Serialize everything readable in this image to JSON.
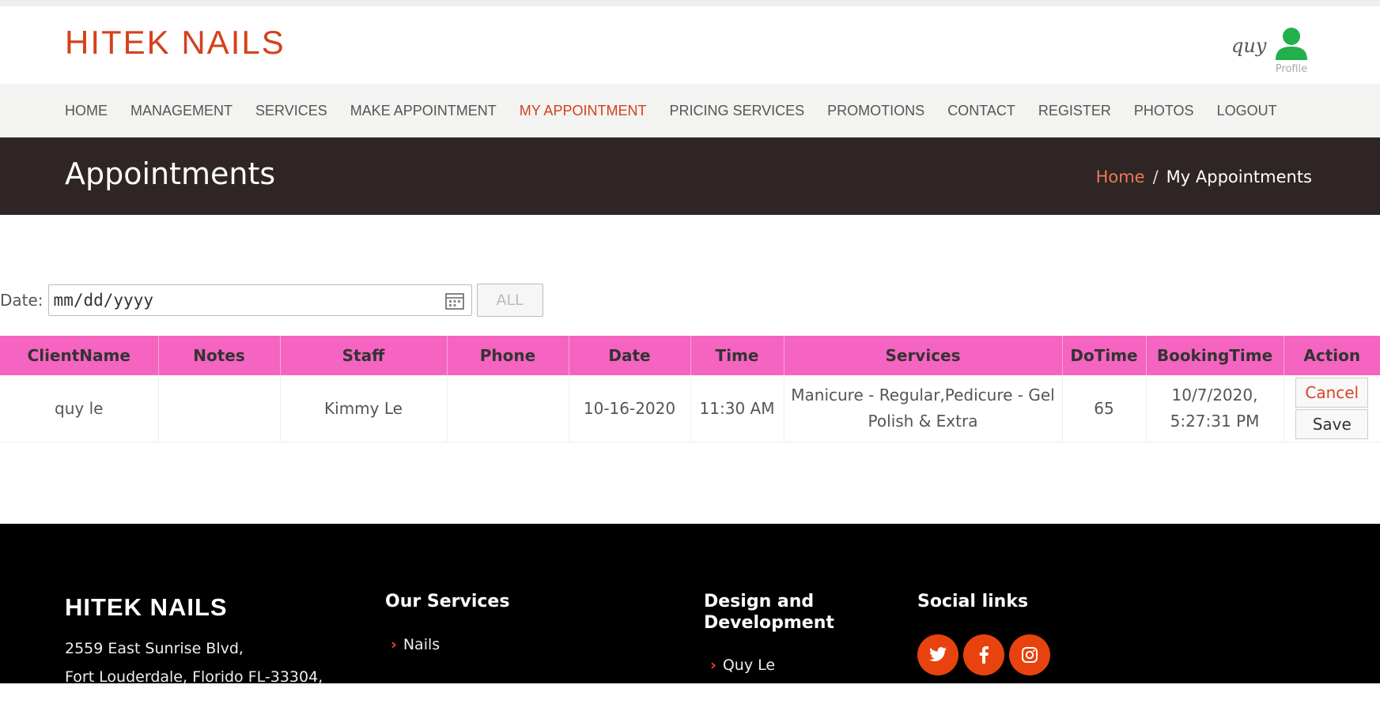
{
  "header": {
    "logo": "HITEK NAILS",
    "user_name": "quy",
    "profile_label": "Profile",
    "profile_color": "#22b04b"
  },
  "nav": {
    "items": [
      {
        "label": "HOME"
      },
      {
        "label": "MANAGEMENT"
      },
      {
        "label": "SERVICES"
      },
      {
        "label": "MAKE APPOINTMENT"
      },
      {
        "label": "MY APPOINTMENT",
        "active": true
      },
      {
        "label": "PRICING SERVICES"
      },
      {
        "label": "PROMOTIONS"
      },
      {
        "label": "CONTACT"
      },
      {
        "label": "REGISTER"
      },
      {
        "label": "PHOTOS"
      },
      {
        "label": "LOGOUT"
      }
    ]
  },
  "banner": {
    "title": "Appointments",
    "breadcrumb_home": "Home",
    "breadcrumb_sep": "/",
    "breadcrumb_current": "My Appointments"
  },
  "filter": {
    "date_label": "Date:",
    "date_placeholder": "mm/dd/yyyy",
    "date_value": "",
    "all_button": "ALL"
  },
  "table": {
    "columns": [
      "ClientName",
      "Notes",
      "Staff",
      "Phone",
      "Date",
      "Time",
      "Services",
      "DoTime",
      "BookingTime",
      "Action"
    ],
    "rows": [
      {
        "client_name": "quy le",
        "notes": "",
        "staff": "Kimmy Le",
        "phone": "",
        "date": "10-16-2020",
        "time": "11:30 AM",
        "services": "Manicure - Regular,Pedicure - Gel Polish & Extra",
        "do_time": "65",
        "booking_time": "10/7/2020, 5:27:31 PM",
        "cancel_label": "Cancel",
        "save_label": "Save"
      }
    ]
  },
  "footer": {
    "brand": "HITEK NAILS",
    "address_line1": "2559 East Sunrise Blvd,",
    "address_line2": "Fort Louderdale, Florido FL-33304,",
    "services_title": "Our Services",
    "services_links": [
      "Nails"
    ],
    "design_title_line1": "Design and",
    "design_title_line2": "Development",
    "design_links": [
      "Quy Le"
    ],
    "social_title": "Social links",
    "social_icons": [
      "twitter-icon",
      "facebook-icon",
      "instagram-icon"
    ],
    "social_color": "#e8430e"
  },
  "colors": {
    "accent": "#d4411e",
    "table_header": "#f564c0",
    "banner": "#2e2524",
    "footer": "#000000"
  }
}
